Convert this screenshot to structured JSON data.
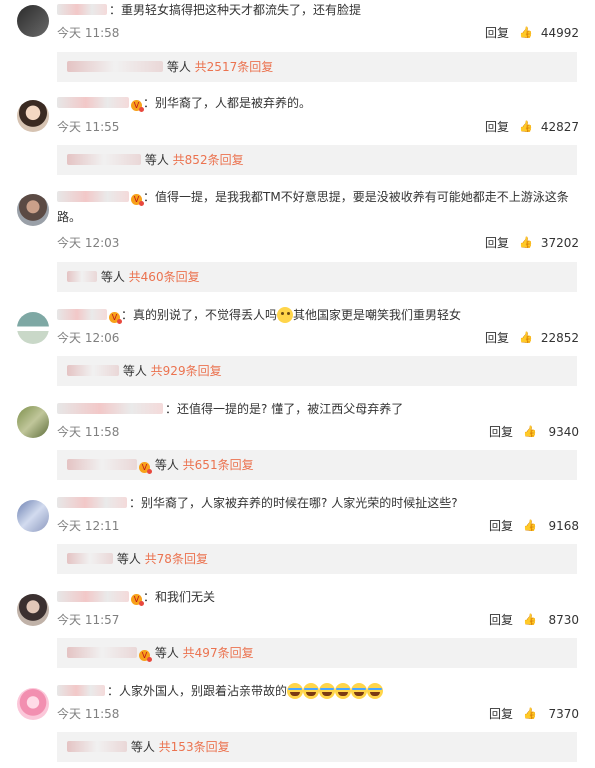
{
  "labels": {
    "reply": "回复",
    "others": "等人",
    "colon": "："
  },
  "comments": [
    {
      "text": "重男轻女搞得把这种天才都流失了，还有脸提",
      "time": "今天 11:58",
      "likes": "44992",
      "replies": "共2517条回复"
    },
    {
      "text": "别华裔了，人都是被弃养的。",
      "time": "今天 11:55",
      "likes": "42827",
      "replies": "共852条回复"
    },
    {
      "text": "值得一提，是我我都TM不好意思提，要是没被收养有可能她都走不上游泳这条路。",
      "time": "今天 12:03",
      "likes": "37202",
      "replies": "共460条回复"
    },
    {
      "text_a": "真的别说了，不觉得丢人吗",
      "text_b": "其他国家更是嘲笑我们重男轻女",
      "time": "今天 12:06",
      "likes": "22852",
      "replies": "共929条回复"
    },
    {
      "text": "还值得一提的是? 懂了，被江西父母弃养了",
      "time": "今天 11:58",
      "likes": "9340",
      "replies": "共651条回复"
    },
    {
      "text": "别华裔了，人家被弃养的时候在哪? 人家光荣的时候扯这些?",
      "time": "今天 12:11",
      "likes": "9168",
      "replies": "共78条回复"
    },
    {
      "text": "和我们无关",
      "time": "今天 11:57",
      "likes": "8730",
      "replies": "共497条回复"
    },
    {
      "text": "人家外国人，别跟着沾亲带故的",
      "time": "今天 11:58",
      "likes": "7370",
      "replies": "共153条回复"
    }
  ],
  "icons": {
    "like": "thumbs-up-icon",
    "vip": "vip-badge-icon",
    "emoji_think": "thinking-face-icon",
    "emoji_laugh": "laugh-cry-icon"
  },
  "colors": {
    "more_replies": "#eb7350",
    "sub_bg": "#f2f2f2",
    "meta": "#808080"
  }
}
